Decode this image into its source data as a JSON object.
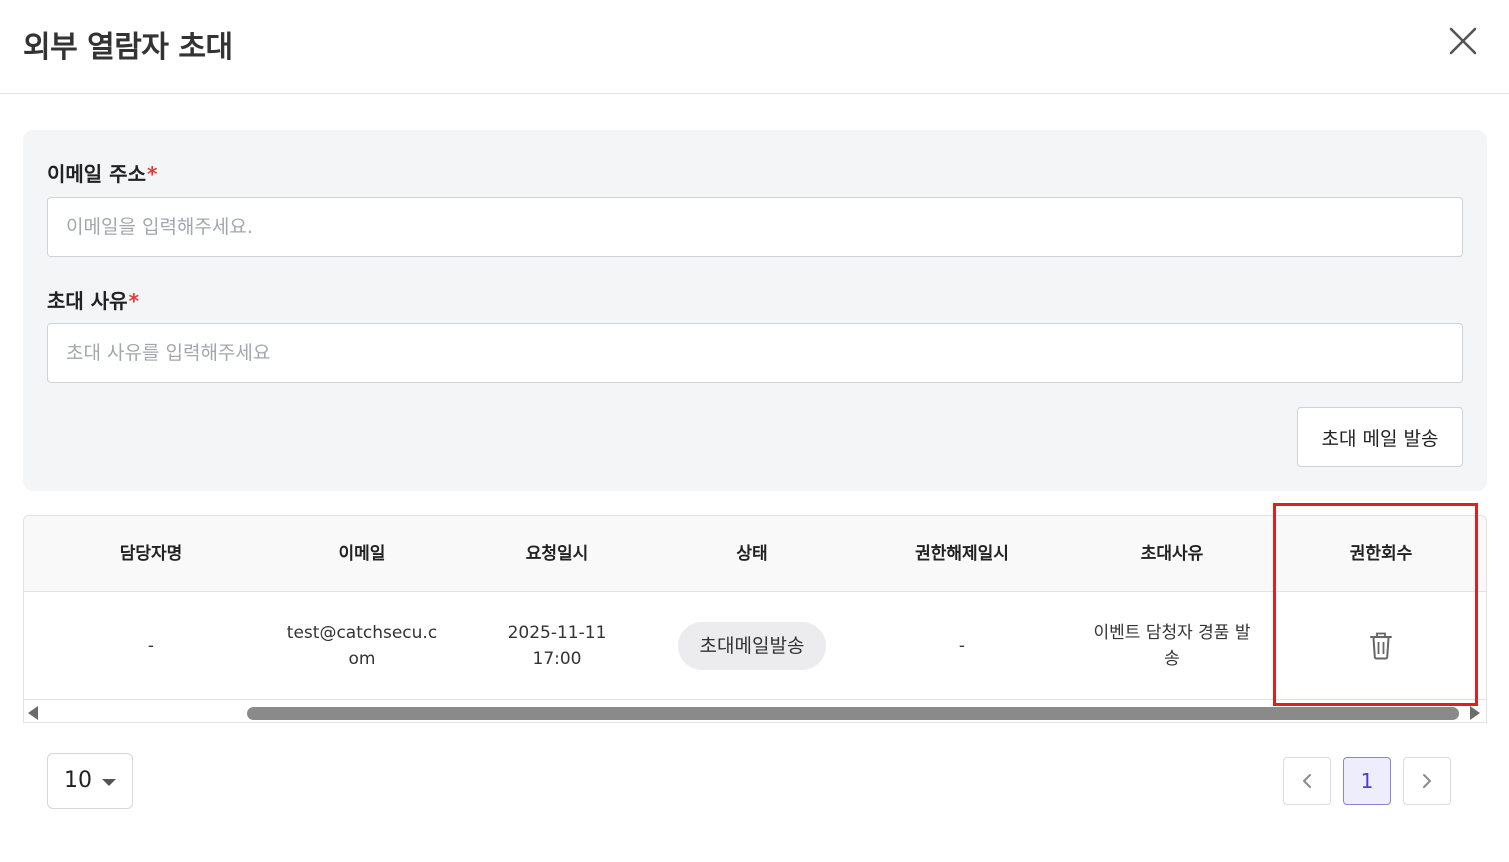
{
  "dialog": {
    "title": "외부 열람자 초대"
  },
  "form": {
    "email_label": "이메일 주소",
    "email_required": "*",
    "email_placeholder": "이메일을 입력해주세요.",
    "reason_label": "초대 사유",
    "reason_required": "*",
    "reason_placeholder": "초대 사유를 입력해주세요",
    "send_button": "초대 메일 발송"
  },
  "table": {
    "headers": [
      "담당자명",
      "이메일",
      "요청일시",
      "상태",
      "권한해제일시",
      "초대사유",
      "권한회수"
    ],
    "rows": [
      {
        "manager": "-",
        "email": "test@catchsecu.com",
        "requested_at": "2025-11-11 17:00",
        "status": "초대메일발송",
        "revoked_at": "-",
        "reason": "이벤트 담청자 경품 발송"
      }
    ]
  },
  "pagination": {
    "page_size": "10",
    "current_page": "1"
  },
  "colors": {
    "highlight": "#e0201f",
    "accent": "#4a3fd0",
    "required": "#e03a3a"
  },
  "icons": {
    "close": "close-icon",
    "delete": "trash-icon",
    "prev": "chevron-left-icon",
    "next": "chevron-right-icon"
  }
}
